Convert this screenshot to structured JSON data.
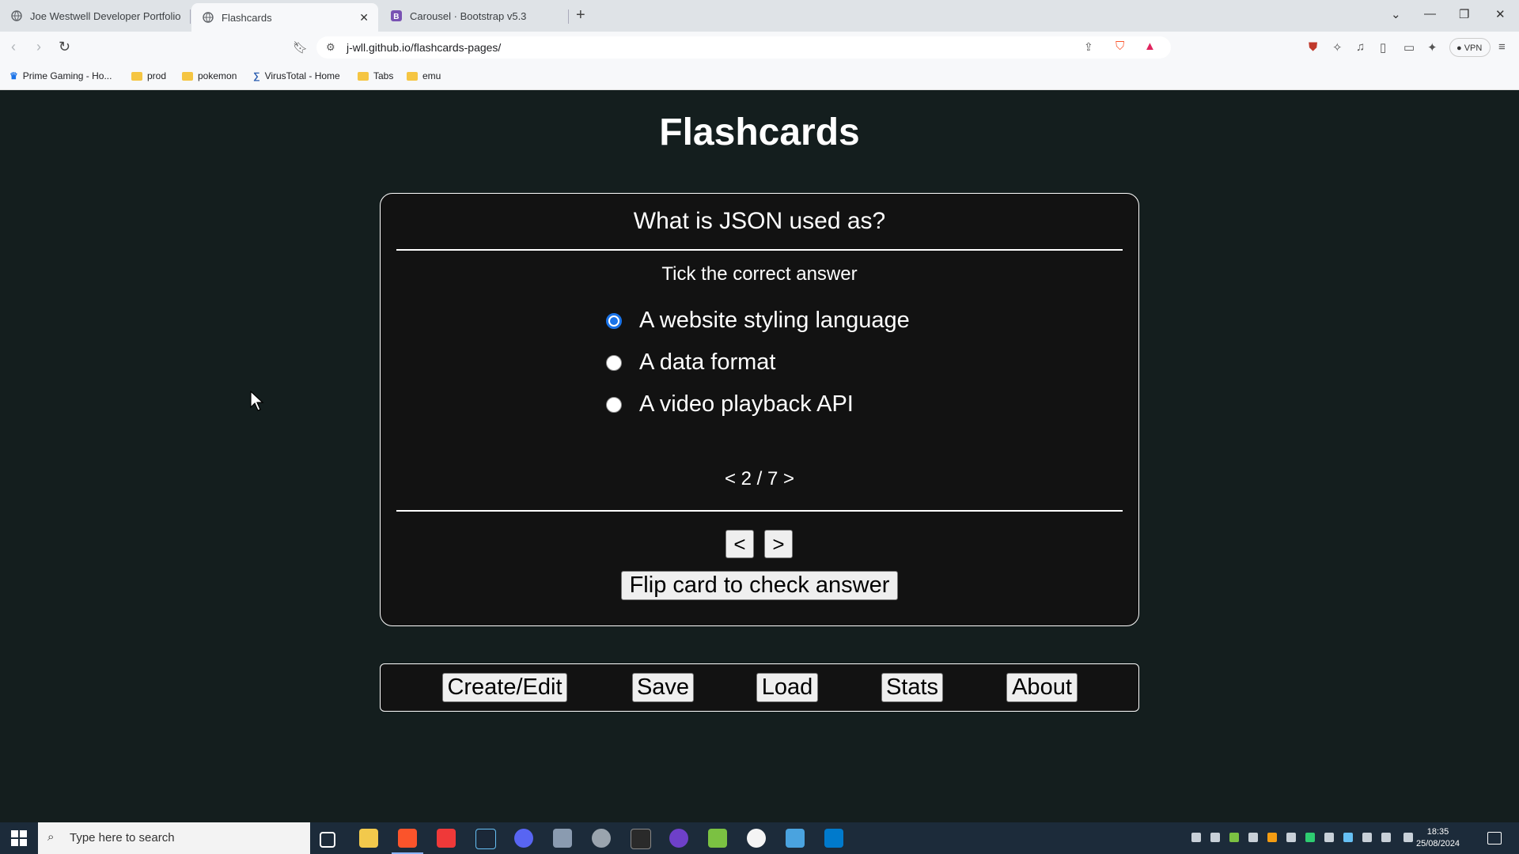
{
  "browser": {
    "tabs": [
      {
        "title": "Joe Westwell Developer Portfolio"
      },
      {
        "title": "Flashcards",
        "active": true
      },
      {
        "title": "Carousel · Bootstrap v5.3"
      }
    ],
    "url": "j-wll.github.io/flashcards-pages/",
    "vpn_label": "VPN",
    "bookmarks": [
      {
        "label": "Prime Gaming - Ho..."
      },
      {
        "label": "prod"
      },
      {
        "label": "pokemon"
      },
      {
        "label": "VirusTotal - Home"
      },
      {
        "label": "Tabs"
      },
      {
        "label": "emu"
      }
    ]
  },
  "app": {
    "title": "Flashcards",
    "card": {
      "question": "What is JSON used as?",
      "instruction": "Tick the correct answer",
      "options": [
        {
          "label": "A website styling language",
          "checked": true
        },
        {
          "label": "A data format",
          "checked": false
        },
        {
          "label": "A video playback API",
          "checked": false
        }
      ],
      "counter": "< 2 / 7 >",
      "prev_label": "<",
      "next_label": ">",
      "flip_label": "Flip card to check answer"
    },
    "menu": {
      "create_edit": "Create/Edit",
      "save": "Save",
      "load": "Load",
      "stats": "Stats",
      "about": "About"
    }
  },
  "taskbar": {
    "search_placeholder": "Type here to search",
    "time": "18:35",
    "date": "25/08/2024"
  },
  "colors": {
    "page_background": "#141e1e",
    "card_background": "#121212",
    "radio_accent": "#1a73e8"
  }
}
